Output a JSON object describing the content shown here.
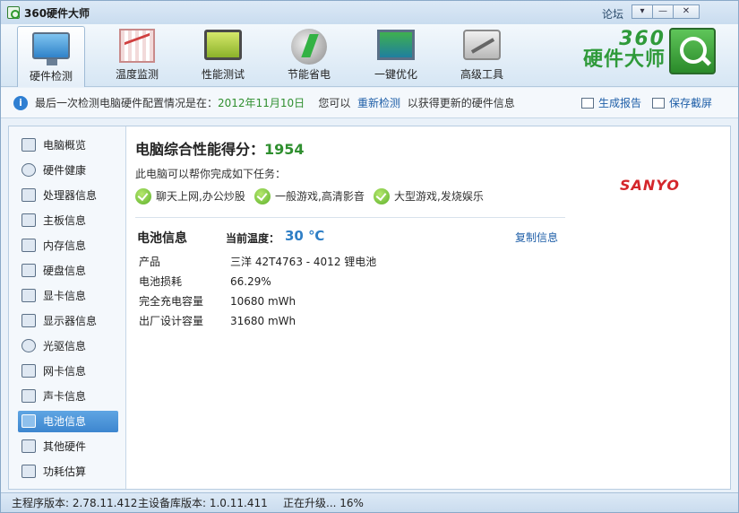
{
  "window": {
    "title": "360硬件大师",
    "forum_link": "论坛",
    "controls": [
      "menu",
      "minimize",
      "close"
    ]
  },
  "toolbar": {
    "items": [
      {
        "label": "硬件检测",
        "icon": "monitor-icon",
        "active": true
      },
      {
        "label": "温度监测",
        "icon": "temperature-chart-icon",
        "active": false
      },
      {
        "label": "性能测试",
        "icon": "performance-screen-icon",
        "active": false
      },
      {
        "label": "节能省电",
        "icon": "power-saving-icon",
        "active": false
      },
      {
        "label": "一键优化",
        "icon": "optimize-icon",
        "active": false
      },
      {
        "label": "高级工具",
        "icon": "toolbox-icon",
        "active": false
      }
    ],
    "brand_360": "360",
    "brand_name": "硬件大师"
  },
  "infobar": {
    "prefix": "最后一次检测电脑硬件配置情况是在：",
    "date": "2012年11月10日",
    "middle": "您可以",
    "recheck_link": "重新检测",
    "suffix": "以获得更新的硬件信息",
    "report_link": "生成报告",
    "screenshot_link": "保存截屏"
  },
  "sidebar": {
    "items": [
      {
        "label": "电脑概览",
        "icon": "computer-overview-icon"
      },
      {
        "label": "硬件健康",
        "icon": "health-icon"
      },
      {
        "label": "处理器信息",
        "icon": "cpu-icon"
      },
      {
        "label": "主板信息",
        "icon": "motherboard-icon"
      },
      {
        "label": "内存信息",
        "icon": "memory-icon"
      },
      {
        "label": "硬盘信息",
        "icon": "hard-disk-icon"
      },
      {
        "label": "显卡信息",
        "icon": "graphics-card-icon"
      },
      {
        "label": "显示器信息",
        "icon": "display-icon"
      },
      {
        "label": "光驱信息",
        "icon": "optical-drive-icon"
      },
      {
        "label": "网卡信息",
        "icon": "network-card-icon"
      },
      {
        "label": "声卡信息",
        "icon": "sound-card-icon"
      },
      {
        "label": "电池信息",
        "icon": "battery-icon",
        "active": true
      },
      {
        "label": "其他硬件",
        "icon": "other-hardware-icon"
      },
      {
        "label": "功耗估算",
        "icon": "power-estimate-icon"
      }
    ]
  },
  "main": {
    "score_label": "电脑综合性能得分：",
    "score_value": "1954",
    "tasks_intro": "此电脑可以帮你完成如下任务：",
    "tasks": [
      "聊天上网,办公炒股",
      "一般游戏,高清影音",
      "大型游戏,发烧娱乐"
    ],
    "brand_logo": "SANYO",
    "battery_title": "电池信息",
    "temperature_label": "当前温度：",
    "temperature_value": "30 ℃",
    "copy_link": "复制信息",
    "rows": [
      {
        "key": "产品",
        "value": "三洋 42T4763 -  4012 锂电池"
      },
      {
        "key": "电池损耗",
        "value": "66.29%"
      },
      {
        "key": "完全充电容量",
        "value": "10680 mWh"
      },
      {
        "key": "出厂设计容量",
        "value": "31680 mWh"
      }
    ]
  },
  "statusbar": {
    "program_version": "主程序版本: 2.78.11.412",
    "database_version": "主设备库版本: 1.0.11.411",
    "update_status": "正在升级... 16%"
  },
  "colors": {
    "accent_green": "#2f8f2f",
    "link_blue": "#1f5fa8",
    "temperature_blue": "#2f7fc6",
    "sidebar_active": "#3d86cf",
    "brand_red": "#d4262b"
  }
}
